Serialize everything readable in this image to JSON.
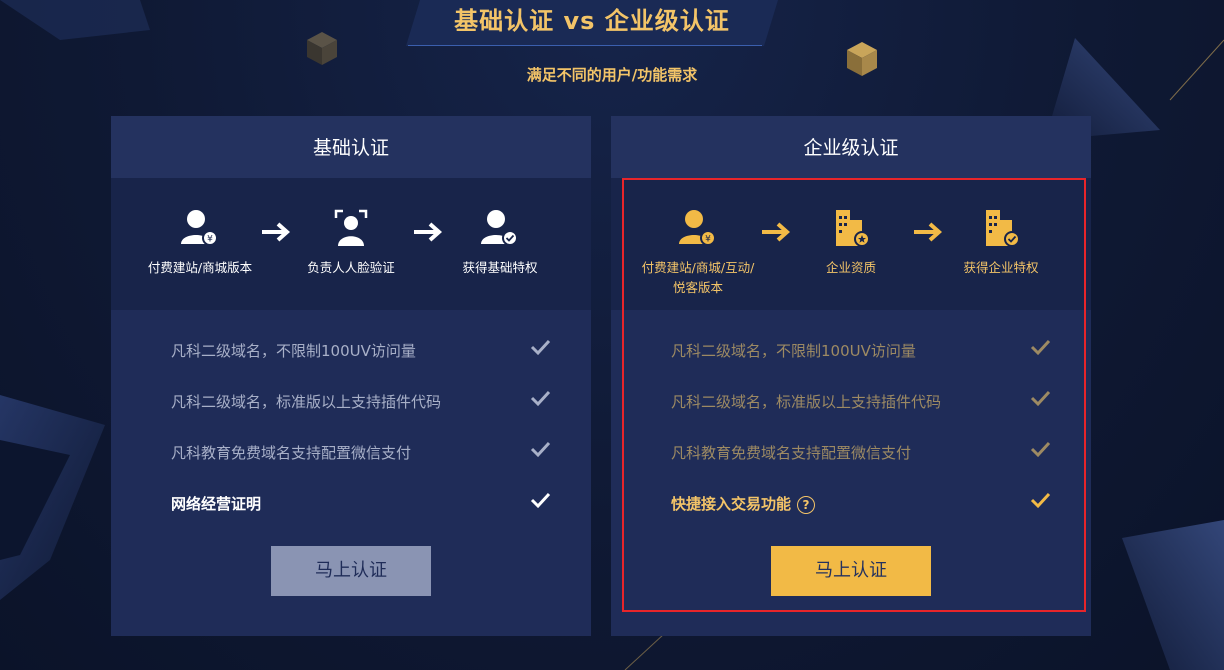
{
  "page": {
    "title": "基础认证 vs 企业级认证",
    "subtitle": "满足不同的用户/功能需求"
  },
  "colors": {
    "background": "#0f1934",
    "card": "#1f2c58",
    "gold": "#f3c468",
    "primary_button": "#f2ba46",
    "disabled_button": "#8a94b3",
    "highlight_border": "#e8252a"
  },
  "basic": {
    "title": "基础认证",
    "steps": [
      {
        "icon": "user-yuan-icon",
        "label": "付费建站/商城版本"
      },
      {
        "icon": "face-scan-icon",
        "label": "负责人人脸验证"
      },
      {
        "icon": "user-check-icon",
        "label": "获得基础特权"
      }
    ],
    "features": [
      "凡科二级域名，不限制100UV访问量",
      "凡科二级域名，标准版以上支持插件代码",
      "凡科教育免费域名支持配置微信支付",
      "网络经营证明"
    ],
    "button": "马上认证"
  },
  "enterprise": {
    "title": "企业级认证",
    "steps": [
      {
        "icon": "user-yuan-icon",
        "label_line1": "付费建站/商城/互动/",
        "label_line2": "悦客版本"
      },
      {
        "icon": "building-star-icon",
        "label": "企业资质"
      },
      {
        "icon": "building-check-icon",
        "label": "获得企业特权"
      }
    ],
    "features": [
      "凡科二级域名，不限制100UV访问量",
      "凡科二级域名，标准版以上支持插件代码",
      "凡科教育免费域名支持配置微信支付",
      "快捷接入交易功能"
    ],
    "help_icon": "?",
    "button": "马上认证"
  }
}
